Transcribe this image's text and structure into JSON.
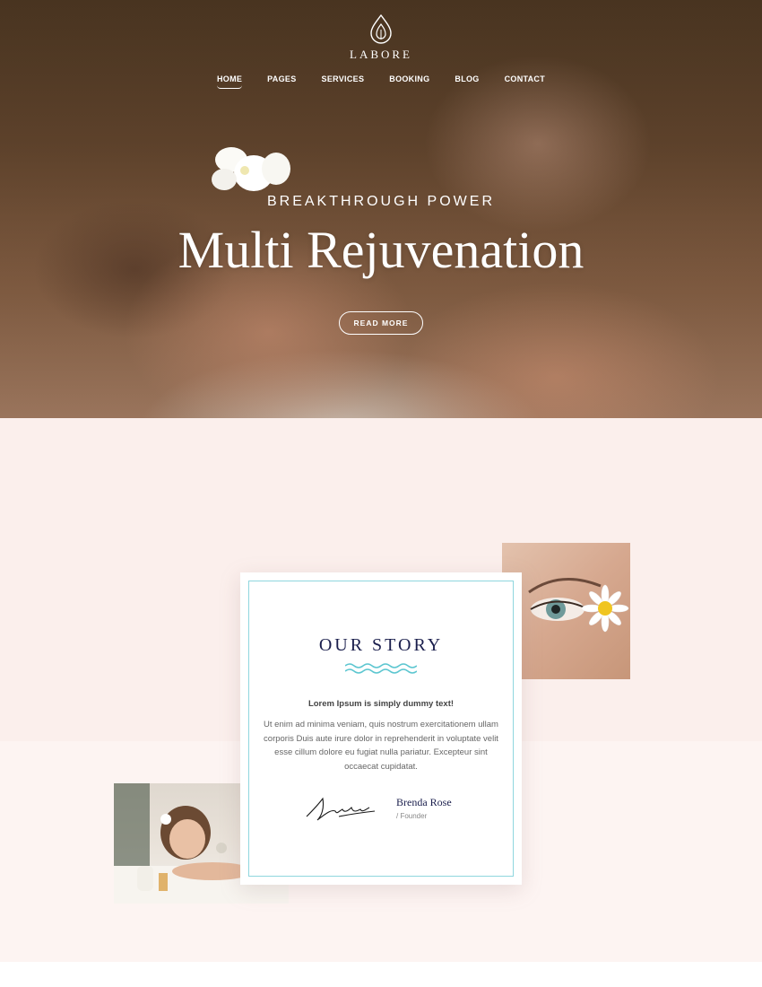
{
  "brand": {
    "name": "LABORE",
    "logo_icon": "lotus-drop-icon"
  },
  "nav": {
    "items": [
      {
        "label": "HOME",
        "active": true
      },
      {
        "label": "PAGES",
        "active": false
      },
      {
        "label": "SERVICES",
        "active": false
      },
      {
        "label": "BOOKING",
        "active": false
      },
      {
        "label": "BLOG",
        "active": false
      },
      {
        "label": "CONTACT",
        "active": false
      }
    ]
  },
  "hero": {
    "kicker": "BREAKTHROUGH POWER",
    "title": "Multi Rejuvenation",
    "button_label": "READ MORE"
  },
  "story": {
    "title": "OUR STORY",
    "lead": "Lorem Ipsum is simply dummy text!",
    "body": "Ut enim ad minima veniam, quis nostrum exercitationem ullam corporis Duis aute irure dolor in reprehenderit in voluptate velit esse cillum dolore eu fugiat nulla pariatur. Excepteur sint occaecat cupidatat.",
    "founder_name": "Brenda Rose",
    "founder_role": "/ Founder"
  },
  "colors": {
    "accent": "#8fd6de",
    "heading": "#1b1f4d",
    "section_bg": "#fbefec"
  }
}
